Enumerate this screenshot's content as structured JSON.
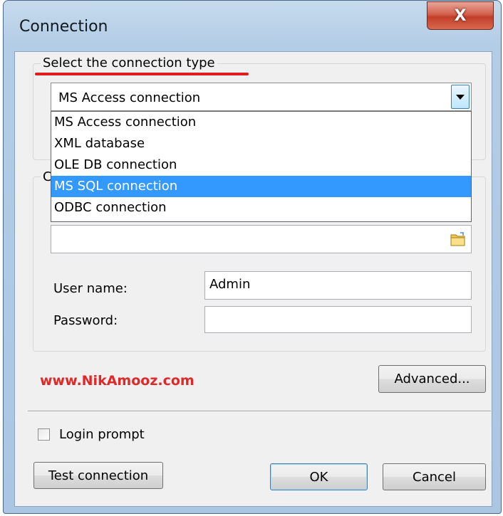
{
  "window": {
    "title": "Connection",
    "close_glyph": "X"
  },
  "connection_type": {
    "legend": "Select the connection type",
    "selected": "MS Access connection",
    "options": [
      "MS Access connection",
      "XML database",
      "OLE DB connection",
      "MS SQL connection",
      "ODBC connection"
    ],
    "highlighted_index": 3
  },
  "details": {
    "legend_fragment": "C",
    "database_path": "",
    "user_name_label": "User name:",
    "user_name_value": "Admin",
    "password_label": "Password:",
    "password_value": ""
  },
  "watermark": "www.NikAmooz.com",
  "buttons": {
    "advanced": "Advanced...",
    "test_connection": "Test connection",
    "ok": "OK",
    "cancel": "Cancel"
  },
  "login_prompt": {
    "label": "Login prompt",
    "checked": false
  },
  "colors": {
    "highlight": "#3399ff",
    "underline": "#e01e1e",
    "watermark": "#e02828",
    "close": "#c23d2a"
  },
  "icons": {
    "close": "close-icon",
    "dropdown": "chevron-down-icon",
    "browse": "folder-icon"
  }
}
